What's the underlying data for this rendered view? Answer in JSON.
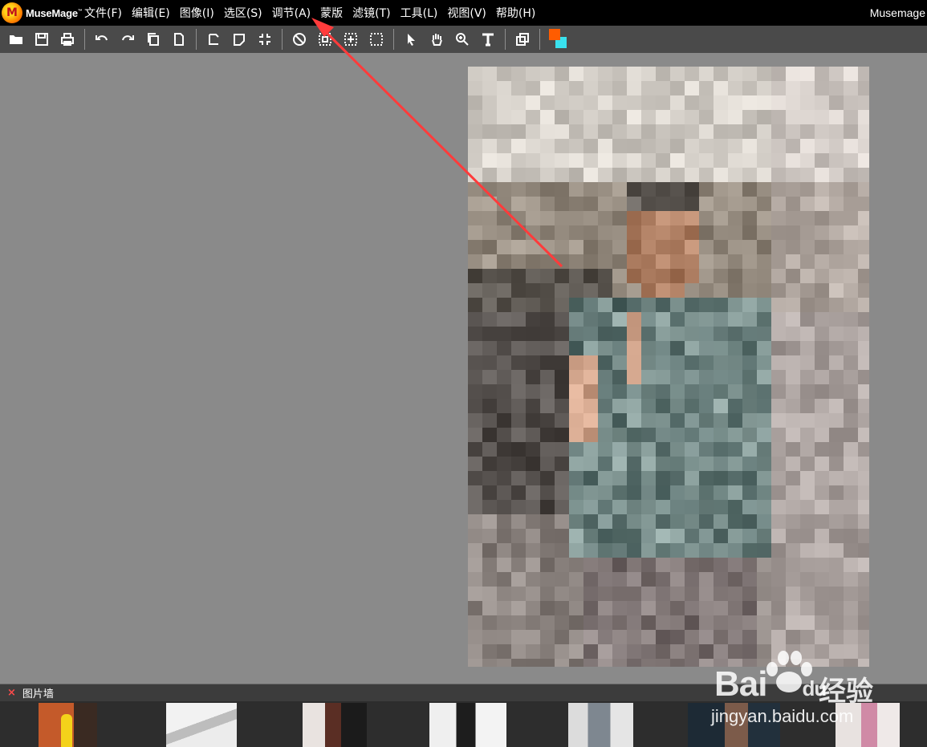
{
  "app": {
    "logo_text": "MuseMage",
    "logo_tm": "™",
    "logo_letter": "M",
    "window_title": "Musemage"
  },
  "menu": [
    {
      "label": "文件(F)",
      "name": "menu-file"
    },
    {
      "label": "编辑(E)",
      "name": "menu-edit"
    },
    {
      "label": "图像(I)",
      "name": "menu-image"
    },
    {
      "label": "选区(S)",
      "name": "menu-select"
    },
    {
      "label": "调节(A)",
      "name": "menu-adjust"
    },
    {
      "label": "蒙版",
      "name": "menu-mask"
    },
    {
      "label": "滤镜(T)",
      "name": "menu-filter"
    },
    {
      "label": "工具(L)",
      "name": "menu-tools"
    },
    {
      "label": "视图(V)",
      "name": "menu-view"
    },
    {
      "label": "帮助(H)",
      "name": "menu-help"
    }
  ],
  "toolbar": {
    "icons": [
      "open-folder-icon",
      "save-icon",
      "print-icon",
      "undo-icon",
      "redo-icon",
      "copy-icon",
      "new-page-icon",
      "rotate-icon",
      "flip-icon",
      "fit-screen-icon",
      "deselect-icon",
      "select-all-icon",
      "select-transform-icon",
      "marquee-icon",
      "pointer-icon",
      "hand-icon",
      "zoom-icon",
      "text-icon",
      "layers-icon"
    ],
    "foreground_color": "#ff5c00",
    "background_color": "#39e1ee"
  },
  "photo_wall": {
    "close_label": "×",
    "title": "图片墙"
  },
  "watermark": {
    "brand": "Bai",
    "brand_du": "du",
    "cn": "经验",
    "url": "jingyan.baidu.com"
  },
  "annotation": {
    "color": "#ff3b3b"
  }
}
